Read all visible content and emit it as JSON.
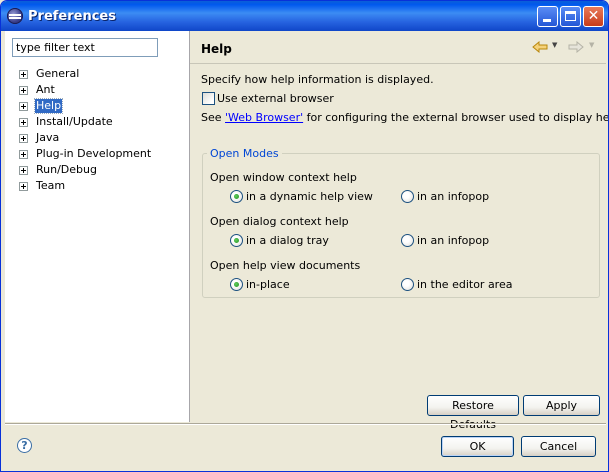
{
  "window": {
    "title": "Preferences",
    "controls": {
      "minimize": "_",
      "maximize": "□",
      "close": "✕"
    }
  },
  "sidebar": {
    "filter_placeholder": "type filter text",
    "items": [
      {
        "label": "General",
        "selected": false
      },
      {
        "label": "Ant",
        "selected": false
      },
      {
        "label": "Help",
        "selected": true
      },
      {
        "label": "Install/Update",
        "selected": false
      },
      {
        "label": "Java",
        "selected": false
      },
      {
        "label": "Plug-in Development",
        "selected": false
      },
      {
        "label": "Run/Debug",
        "selected": false
      },
      {
        "label": "Team",
        "selected": false
      }
    ]
  },
  "page": {
    "title": "Help",
    "nav": {
      "back_icon": "back-arrow-icon",
      "forward_icon": "forward-arrow-icon"
    },
    "description": "Specify how help information is displayed.",
    "external_browser": {
      "label": "Use external browser",
      "checked": false
    },
    "see_prefix": "See ",
    "see_link": "'Web Browser'",
    "see_suffix": " for configuring the external browser used to display help topics.",
    "open_modes": {
      "title": "Open Modes",
      "window_context": {
        "label": "Open window context help",
        "option_a": "in a dynamic help view",
        "option_b": "in an infopop",
        "selected": "a"
      },
      "dialog_context": {
        "label": "Open dialog context help",
        "option_a": "in a dialog tray",
        "option_b": "in an infopop",
        "selected": "a"
      },
      "help_view_docs": {
        "label": "Open help view documents",
        "option_a": "in-place",
        "option_b": "in the editor area",
        "selected": "a"
      }
    },
    "restore_defaults": "Restore Defaults",
    "apply": "Apply"
  },
  "footer": {
    "help_glyph": "?",
    "ok": "OK",
    "cancel": "Cancel"
  },
  "colors": {
    "titlebar": "#2663e0",
    "selection": "#316ac5",
    "group_title": "#0046d5",
    "link": "#0000ff"
  }
}
